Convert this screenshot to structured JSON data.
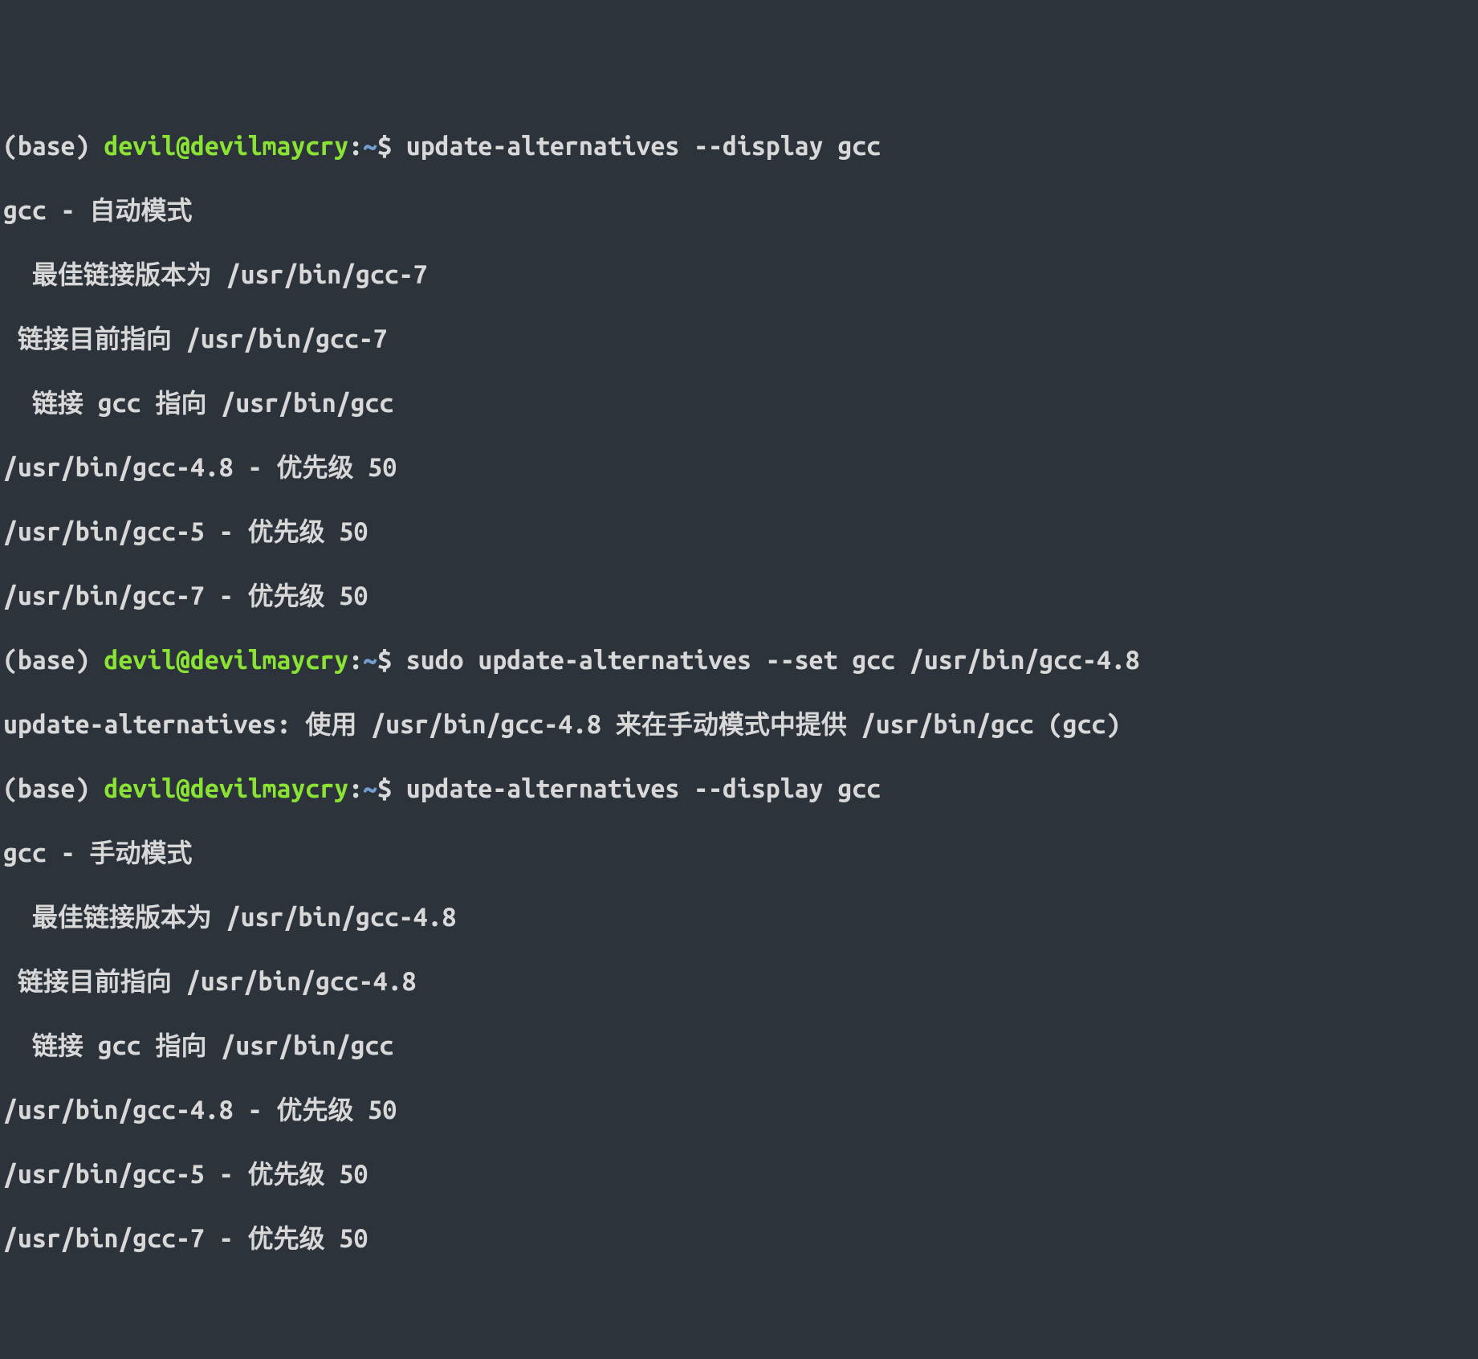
{
  "lines": [
    {
      "type": "prompt",
      "env": "(base) ",
      "userhost": "devil@devilmaycry",
      "colon": ":",
      "path": "~",
      "dollar": "$ ",
      "command": "update-alternatives --display gcc"
    },
    {
      "type": "output",
      "text": "gcc - 自动模式"
    },
    {
      "type": "output",
      "text": "  最佳链接版本为 /usr/bin/gcc-7"
    },
    {
      "type": "output",
      "text": " 链接目前指向 /usr/bin/gcc-7"
    },
    {
      "type": "output",
      "text": "  链接 gcc 指向 /usr/bin/gcc"
    },
    {
      "type": "output",
      "text": "/usr/bin/gcc-4.8 - 优先级 50"
    },
    {
      "type": "output",
      "text": "/usr/bin/gcc-5 - 优先级 50"
    },
    {
      "type": "output",
      "text": "/usr/bin/gcc-7 - 优先级 50"
    },
    {
      "type": "prompt",
      "env": "(base) ",
      "userhost": "devil@devilmaycry",
      "colon": ":",
      "path": "~",
      "dollar": "$ ",
      "command": "sudo update-alternatives --set gcc /usr/bin/gcc-4.8"
    },
    {
      "type": "output",
      "text": "update-alternatives: 使用 /usr/bin/gcc-4.8 来在手动模式中提供 /usr/bin/gcc (gcc)"
    },
    {
      "type": "prompt",
      "env": "(base) ",
      "userhost": "devil@devilmaycry",
      "colon": ":",
      "path": "~",
      "dollar": "$ ",
      "command": "update-alternatives --display gcc"
    },
    {
      "type": "output",
      "text": "gcc - 手动模式"
    },
    {
      "type": "output",
      "text": "  最佳链接版本为 /usr/bin/gcc-4.8"
    },
    {
      "type": "output",
      "text": " 链接目前指向 /usr/bin/gcc-4.8"
    },
    {
      "type": "output",
      "text": "  链接 gcc 指向 /usr/bin/gcc"
    },
    {
      "type": "output",
      "text": "/usr/bin/gcc-4.8 - 优先级 50"
    },
    {
      "type": "output",
      "text": "/usr/bin/gcc-5 - 优先级 50"
    },
    {
      "type": "output",
      "text": "/usr/bin/gcc-7 - 优先级 50"
    }
  ]
}
